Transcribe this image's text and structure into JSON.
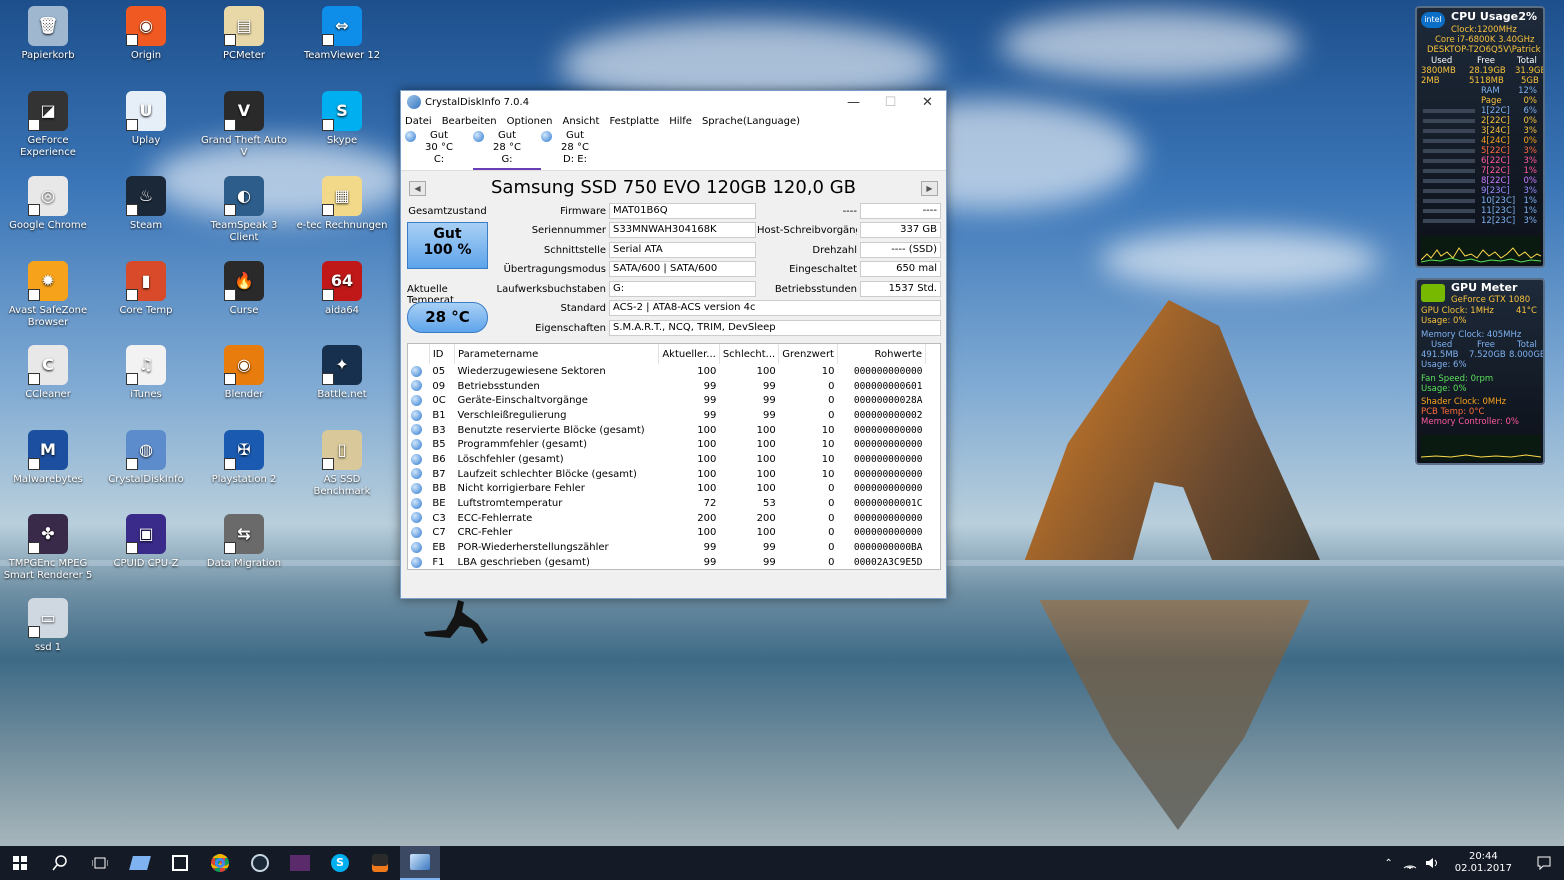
{
  "desktop": {
    "icons": [
      {
        "label": "Papierkorb",
        "color": "#9fb8d0",
        "glyph": "🗑"
      },
      {
        "label": "Origin",
        "color": "#f05a22",
        "glyph": "◉"
      },
      {
        "label": "PCMeter",
        "color": "#e8d8a8",
        "glyph": "▤"
      },
      {
        "label": "TeamViewer 12",
        "color": "#0e8ee9",
        "glyph": "⇔"
      },
      {
        "label": "GeForce Experience",
        "color": "#333",
        "glyph": "◪"
      },
      {
        "label": "Uplay",
        "color": "#e6eef8",
        "glyph": "U"
      },
      {
        "label": "Grand Theft Auto V",
        "color": "#2a2a2a",
        "glyph": "V"
      },
      {
        "label": "Skype",
        "color": "#00aff0",
        "glyph": "S"
      },
      {
        "label": "Google Chrome",
        "color": "#e8e8e8",
        "glyph": "◎"
      },
      {
        "label": "Steam",
        "color": "#1b2838",
        "glyph": "♨"
      },
      {
        "label": "TeamSpeak 3 Client",
        "color": "#2d5d8a",
        "glyph": "◐"
      },
      {
        "label": "e-tec Rechnungen",
        "color": "#f2d98a",
        "glyph": "▦"
      },
      {
        "label": "Avast SafeZone Browser",
        "color": "#f7a21b",
        "glyph": "✹"
      },
      {
        "label": "Core Temp",
        "color": "#d84a2a",
        "glyph": "▮"
      },
      {
        "label": "Curse",
        "color": "#2a2a2a",
        "glyph": "🔥"
      },
      {
        "label": "aida64",
        "color": "#c01818",
        "glyph": "64"
      },
      {
        "label": "CCleaner",
        "color": "#e8e8e8",
        "glyph": "C"
      },
      {
        "label": "iTunes",
        "color": "#f2f2f2",
        "glyph": "♫"
      },
      {
        "label": "Blender",
        "color": "#e87d0d",
        "glyph": "◉"
      },
      {
        "label": "Battle.net",
        "color": "#16304d",
        "glyph": "✦"
      },
      {
        "label": "Malwarebytes",
        "color": "#1d4fa0",
        "glyph": "M"
      },
      {
        "label": "CrystalDiskInfo",
        "color": "#5d8ccc",
        "glyph": "◍"
      },
      {
        "label": "Playstation 2",
        "color": "#1a5ab0",
        "glyph": "✠"
      },
      {
        "label": "AS SSD Benchmark",
        "color": "#d8c89a",
        "glyph": "▯"
      },
      {
        "label": "TMPGEnc MPEG Smart Renderer 5",
        "color": "#3a2a4a",
        "glyph": "✤"
      },
      {
        "label": "CPUID CPU-Z",
        "color": "#3a2a8a",
        "glyph": "▣"
      },
      {
        "label": "Data Migration",
        "color": "#6a6a6a",
        "glyph": "⇆"
      },
      {
        "label": "",
        "color": "transparent",
        "glyph": ""
      },
      {
        "label": "ssd 1",
        "color": "#cfd8e0",
        "glyph": "▭"
      }
    ]
  },
  "window": {
    "title": "CrystalDiskInfo 7.0.4",
    "controls": {
      "minimize": "—",
      "maximize": "☐",
      "close": "✕"
    },
    "menu": [
      "Datei",
      "Bearbeiten",
      "Optionen",
      "Ansicht",
      "Festplatte",
      "Hilfe",
      "Sprache(Language)"
    ],
    "drives": [
      {
        "status": "Gut",
        "temp": "30 °C",
        "letter": "C:"
      },
      {
        "status": "Gut",
        "temp": "28 °C",
        "letter": "G:"
      },
      {
        "status": "Gut",
        "temp": "28 °C",
        "letter": "D: E:"
      }
    ],
    "model": "Samsung SSD 750 EVO 120GB 120,0 GB",
    "prev": "◀",
    "next": "▶",
    "health_label": "Gesamtzustand",
    "health_status": "Gut",
    "health_percent": "100 %",
    "temp_label": "Aktuelle Temperat",
    "temp_value": "28 °C",
    "info": {
      "firmware_label": "Firmware",
      "firmware": "MAT01B6Q",
      "serial_label": "Seriennummer",
      "serial": "S33MNWAH304168K",
      "interface_label": "Schnittstelle",
      "interface": "Serial ATA",
      "transfer_label": "Übertragungsmodus",
      "transfer": "SATA/600 | SATA/600",
      "letters_label": "Laufwerksbuchstaben",
      "letters": "G:",
      "standard_label": "Standard",
      "standard": "ACS-2 | ATA8-ACS version 4c",
      "features_label": "Eigenschaften",
      "features": "S.M.A.R.T., NCQ, TRIM, DevSleep",
      "r1_label": "----",
      "r1": "----",
      "host_writes_label": "Host-Schreibvorgänge",
      "host_writes": "337 GB",
      "rpm_label": "Drehzahl",
      "rpm": "---- (SSD)",
      "power_on_count_label": "Eingeschaltet",
      "power_on_count": "650 mal",
      "power_on_hours_label": "Betriebsstunden",
      "power_on_hours": "1537 Std."
    },
    "smart": {
      "columns": [
        "",
        "ID",
        "Parametername",
        "Aktueller...",
        "Schlecht...",
        "Grenzwert",
        "Rohwerte"
      ],
      "rows": [
        [
          "05",
          "Wiederzugewiesene Sektoren",
          "100",
          "100",
          "10",
          "000000000000"
        ],
        [
          "09",
          "Betriebsstunden",
          "99",
          "99",
          "0",
          "000000000601"
        ],
        [
          "0C",
          "Geräte-Einschaltvorgänge",
          "99",
          "99",
          "0",
          "00000000028A"
        ],
        [
          "B1",
          "Verschleißregulierung",
          "99",
          "99",
          "0",
          "000000000002"
        ],
        [
          "B3",
          "Benutzte reservierte Blöcke (gesamt)",
          "100",
          "100",
          "10",
          "000000000000"
        ],
        [
          "B5",
          "Programmfehler (gesamt)",
          "100",
          "100",
          "10",
          "000000000000"
        ],
        [
          "B6",
          "Löschfehler (gesamt)",
          "100",
          "100",
          "10",
          "000000000000"
        ],
        [
          "B7",
          "Laufzeit schlechter Blöcke (gesamt)",
          "100",
          "100",
          "10",
          "000000000000"
        ],
        [
          "BB",
          "Nicht korrigierbare Fehler",
          "100",
          "100",
          "0",
          "000000000000"
        ],
        [
          "BE",
          "Luftstromtemperatur",
          "72",
          "53",
          "0",
          "00000000001C"
        ],
        [
          "C3",
          "ECC-Fehlerrate",
          "200",
          "200",
          "0",
          "000000000000"
        ],
        [
          "C7",
          "CRC-Fehler",
          "100",
          "100",
          "0",
          "000000000000"
        ],
        [
          "EB",
          "POR-Wiederherstellungszähler",
          "99",
          "99",
          "0",
          "0000000000BA"
        ],
        [
          "F1",
          "LBA geschrieben (gesamt)",
          "99",
          "99",
          "0",
          "00002A3C9E5D"
        ]
      ]
    }
  },
  "cpu_gadget": {
    "title": "CPU Usage",
    "percent": "2%",
    "clock": "Clock:1200MHz",
    "cpu": "Core i7-6800K 3.40GHz",
    "host": "DESKTOP-T2O6Q5V\\Patrick",
    "hdr_used": "Used",
    "hdr_free": "Free",
    "hdr_total": "Total",
    "r1": [
      "3800MB",
      "28.19GB",
      "31.9GB"
    ],
    "r2": [
      "2MB",
      "5118MB",
      "5GB"
    ],
    "ram_label": "RAM",
    "ram": "12%",
    "page_label": "Page",
    "page": "0%",
    "cores": [
      [
        "1[22C]",
        "6%"
      ],
      [
        "2[22C]",
        "0%"
      ],
      [
        "3[24C]",
        "3%"
      ],
      [
        "4[24C]",
        "0%"
      ],
      [
        "5[22C]",
        "3%"
      ],
      [
        "6[22C]",
        "3%"
      ],
      [
        "7[22C]",
        "1%"
      ],
      [
        "8[22C]",
        "0%"
      ],
      [
        "9[23C]",
        "3%"
      ],
      [
        "10[23C]",
        "1%"
      ],
      [
        "11[23C]",
        "1%"
      ],
      [
        "12[23C]",
        "3%"
      ]
    ]
  },
  "gpu_gadget": {
    "title": "GPU Meter",
    "card": "GeForce GTX 1080",
    "clock": "GPU Clock: 1MHz",
    "temp": "41°C",
    "usage": "Usage: 0%",
    "mem_clock": "Memory Clock: 405MHz",
    "hdr_used": "Used",
    "hdr_free": "Free",
    "hdr_total": "Total",
    "mem": [
      "491.5MB",
      "7.520GB",
      "8.000GB"
    ],
    "mem_usage": "Usage: 6%",
    "fan": "Fan Speed: 0rpm",
    "fan_usage": "Usage: 0%",
    "shader": "Shader Clock: 0MHz",
    "pcb": "PCB Temp: 0°C",
    "memctl": "Memory Controller: 0%"
  },
  "taskbar": {
    "time": "20:44",
    "date": "02.01.2017"
  }
}
